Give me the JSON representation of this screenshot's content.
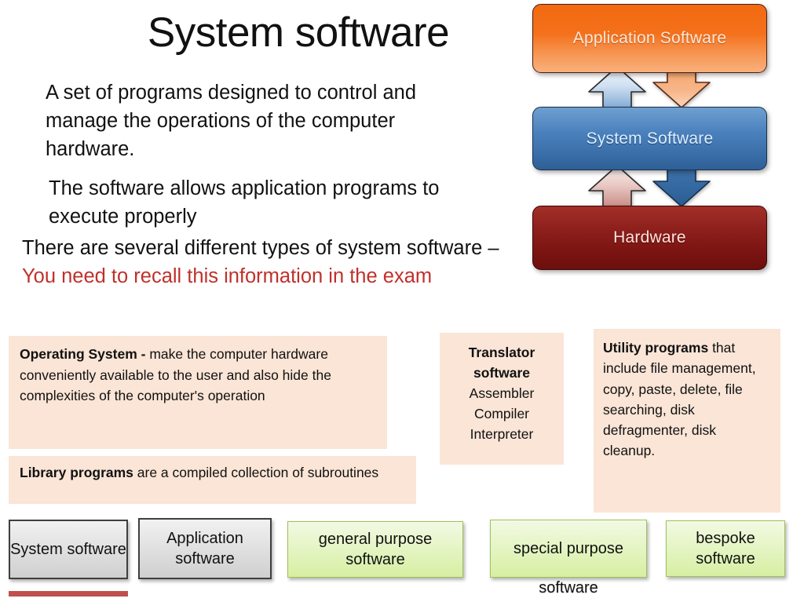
{
  "slide": {
    "title": "System software",
    "intro": {
      "paragraph_1": "A set of programs designed to control and manage the operations of the computer hardware.",
      "paragraph_2": "The software allows application programs to execute properly",
      "paragraph_3_lead": "There are several different types of system software – ",
      "paragraph_3_accent": "You need to recall this information in the exam"
    }
  },
  "diagram": {
    "type": "layered-stack",
    "layers": [
      {
        "name": "application",
        "label": "Application Software",
        "color": "#F26A11"
      },
      {
        "name": "system",
        "label": "System Software",
        "color": "#4A81BD"
      },
      {
        "name": "hardware",
        "label": "Hardware",
        "color": "#8E201C"
      }
    ],
    "arrows": [
      {
        "name": "application-to-system",
        "direction": "down",
        "color": "#F9B07C"
      },
      {
        "name": "system-to-application",
        "direction": "up",
        "color": "#C9DCF0"
      },
      {
        "name": "system-to-hardware",
        "direction": "down",
        "color": "#2F5F96"
      },
      {
        "name": "hardware-to-system",
        "direction": "up",
        "color": "#E8C4C0"
      }
    ]
  },
  "info_boxes": {
    "operating_system": {
      "heading": "Operating System -",
      "body": " make the computer hardware conveniently available to the user and also hide the complexities of the computer's operation"
    },
    "library_programs": {
      "heading": "Library programs",
      "body": " are a compiled collection of subroutines"
    },
    "translator_software": {
      "heading_line_1": "Translator",
      "heading_line_2": "software",
      "items": [
        "Assembler",
        "Compiler",
        "Interpreter"
      ]
    },
    "utility_programs": {
      "heading": "Utility programs",
      "body": " that include file management, copy, paste, delete, file searching, disk defragmenter, disk cleanup."
    }
  },
  "categories": [
    {
      "name": "system-software",
      "label": "System software",
      "style": "grey"
    },
    {
      "name": "application-software",
      "label": "Application software",
      "style": "grey"
    },
    {
      "name": "general-purpose",
      "label": "general purpose software",
      "style": "green"
    },
    {
      "name": "special-purpose",
      "label": "special purpose",
      "overflow": "software",
      "style": "green"
    },
    {
      "name": "bespoke",
      "label": "bespoke software",
      "style": "green"
    }
  ],
  "colors": {
    "peach_panel": "#FAE5D6",
    "accent_red_text": "#C0302B",
    "red_underline": "#C0504D",
    "green_panel": "#E6F5C6",
    "grey_panel": "#E2E2E2"
  }
}
